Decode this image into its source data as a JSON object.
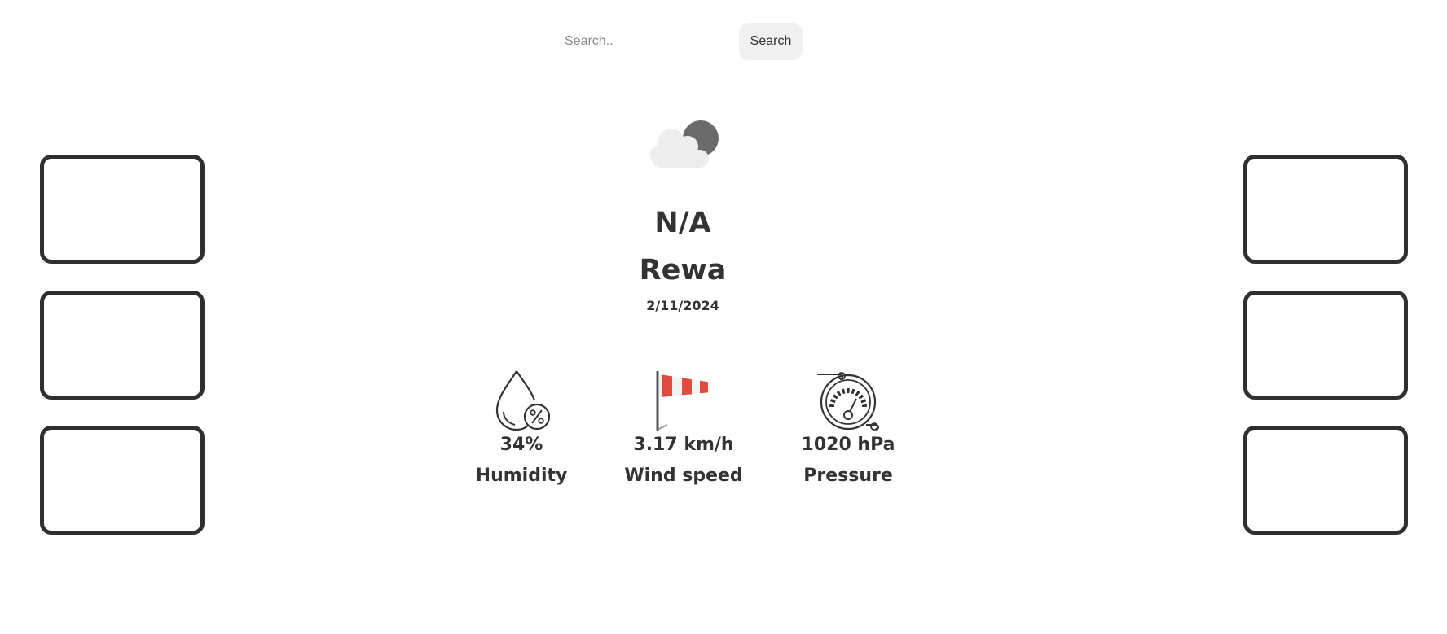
{
  "search": {
    "placeholder": "Search..",
    "button_label": "Search"
  },
  "weather": {
    "icon": "cloud-moon-icon",
    "temperature": "N/A",
    "city": "Rewa",
    "date": "2/11/2024"
  },
  "stats": {
    "humidity": {
      "icon": "humidity-drop-icon",
      "value": "34%",
      "label": "Humidity"
    },
    "wind": {
      "icon": "windsock-icon",
      "value": "3.17 km/h",
      "label": "Wind speed"
    },
    "pressure": {
      "icon": "pressure-gauge-icon",
      "value": "1020 hPa",
      "label": "Pressure"
    }
  },
  "colors": {
    "text": "#333333",
    "box_border": "#2f2f2f",
    "button_bg": "#f0f0f0",
    "windsock_red": "#e04b3f"
  }
}
